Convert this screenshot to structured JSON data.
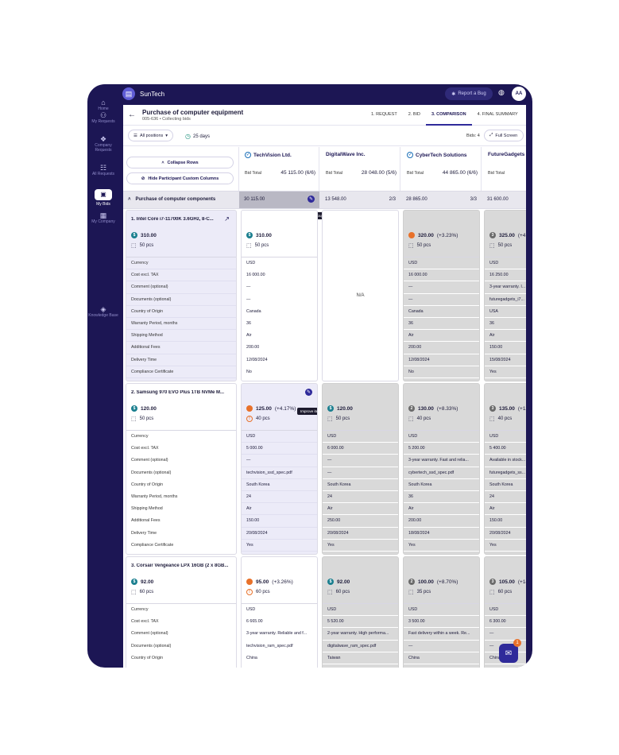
{
  "app": {
    "brand": "SunTech",
    "report_bug": "Report a Bug",
    "avatar": "AA"
  },
  "sidebar": [
    {
      "label": "Home",
      "icon": "home-icon"
    },
    {
      "label": "My Requests",
      "icon": "requests-icon"
    },
    {
      "label": "Company Requests",
      "icon": "company-requests-icon"
    },
    {
      "label": "All Requests",
      "icon": "all-requests-icon"
    },
    {
      "label": "My Bids",
      "icon": "bids-icon",
      "active": true
    },
    {
      "label": "My Company",
      "icon": "company-icon"
    },
    {
      "label": "Knowledge Base",
      "icon": "knowledge-icon"
    }
  ],
  "header": {
    "title": "Purchase of computer equipment",
    "subtitle": "005-636 • Collecting bids",
    "steps": [
      "1. REQUEST",
      "2. BID",
      "3. COMPARISON",
      "4. FINAL SUMMARY"
    ]
  },
  "toolbar": {
    "positions": "All positions",
    "days": "25 days",
    "bids": "Bids: 4",
    "fullscreen": "Full Screen",
    "collapse": "Collapse Rows",
    "hide_columns": "Hide Participant Custom Columns"
  },
  "suppliers": [
    {
      "name": "TechVision Ltd.",
      "bid_total_label": "Bid Total",
      "bid_total": "45 115.00 (6/6)",
      "verified": true
    },
    {
      "name": "DigitalWave Inc.",
      "bid_total_label": "Bid Total",
      "bid_total": "28 048.00 (5/6)",
      "verified": false
    },
    {
      "name": "CyberTech Solutions",
      "bid_total_label": "Bid Total",
      "bid_total": "44 865.00 (6/6)",
      "verified": true
    },
    {
      "name": "FutureGadgets C",
      "bid_total_label": "Bid Total",
      "bid_total": "",
      "verified": false
    }
  ],
  "group": {
    "title": "Purchase of computer components",
    "totals": [
      {
        "value": "30 115.00",
        "count": ""
      },
      {
        "value": "13 548.00",
        "count": "2/3"
      },
      {
        "value": "28 865.00",
        "count": "3/3"
      },
      {
        "value": "31 600.00",
        "count": ""
      }
    ],
    "tooltip_group": "Improve group",
    "tooltip_item": "Improve item"
  },
  "field_labels": [
    "Currency",
    "Cost excl. TAX",
    "Comment (optional)",
    "Documents (optional)",
    "Country of Origin",
    "Warranty Period, months",
    "Shipping Method",
    "Additional Fees",
    "Delivery Time",
    "Compliance Certificate"
  ],
  "items": [
    {
      "name": "1. Intel Core i7-11700K 3.6GHz, 8-C...",
      "price": "310.00",
      "qty": "50 pcs",
      "offers": [
        {
          "price": "310.00",
          "delta": "",
          "qty": "50 pcs",
          "dot": "teal",
          "values": [
            "USD",
            "16 000.00",
            "—",
            "—",
            "Canada",
            "36",
            "Air",
            "200.00",
            "12/08/2024",
            "No"
          ]
        },
        {
          "na": "N/A"
        },
        {
          "price": "320.00",
          "delta": "(+3.23%)",
          "qty": "50 pcs",
          "dot": "orange",
          "values": [
            "USD",
            "16 000.00",
            "—",
            "—",
            "Canada",
            "36",
            "Air",
            "200.00",
            "12/08/2024",
            "No"
          ]
        },
        {
          "price": "325.00",
          "delta": "(+4...",
          "qty": "50 pcs",
          "dot": "gray",
          "values": [
            "USD",
            "16 250.00",
            "3-year warranty. I...",
            "futuregadgets_i7...",
            "USA",
            "36",
            "Air",
            "150.00",
            "15/08/2024",
            "Yes"
          ]
        }
      ]
    },
    {
      "name": "2. Samsung 970 EVO Plus 1TB NVMe M...",
      "price": "120.00",
      "qty": "50 pcs",
      "offers": [
        {
          "price": "125.00",
          "delta": "(+4.17%)",
          "qty": "40 pcs",
          "dot": "orange",
          "warn": true,
          "values": [
            "USD",
            "5 000.00",
            "—",
            "techvision_ssd_spec.pdf",
            "South Korea",
            "24",
            "Air",
            "150.00",
            "20/08/2024",
            "Yes"
          ]
        },
        {
          "price": "120.00",
          "delta": "",
          "qty": "50 pcs",
          "dot": "teal",
          "values": [
            "USD",
            "6 000.00",
            "—",
            "—",
            "South Korea",
            "24",
            "Air",
            "250.00",
            "20/08/2024",
            "Yes"
          ]
        },
        {
          "price": "130.00",
          "delta": "(+8.33%)",
          "qty": "40 pcs",
          "dot": "gray",
          "values": [
            "USD",
            "5 200.00",
            "3-year warranty. Fast and relia...",
            "cybertech_ssd_spec.pdf",
            "South Korea",
            "36",
            "Air",
            "200.00",
            "18/08/2024",
            "Yes"
          ]
        },
        {
          "price": "135.00",
          "delta": "(+12...",
          "qty": "40 pcs",
          "dot": "gray",
          "values": [
            "USD",
            "5 400.00",
            "Available in stock...",
            "futuregadgets_ss...",
            "South Korea",
            "24",
            "Air",
            "150.00",
            "20/08/2024",
            "Yes"
          ]
        }
      ]
    },
    {
      "name": "3. Corsair Vengeance LPX 16GB (2 x 8GB...",
      "price": "92.00",
      "qty": "60 pcs",
      "offers": [
        {
          "price": "95.00",
          "delta": "(+3.26%)",
          "qty": "60 pcs",
          "dot": "orange",
          "warn": true,
          "values": [
            "USD",
            "6 665.00",
            "3-year warranty. Reliable and f...",
            "techvision_ram_spec.pdf",
            "China",
            "36"
          ]
        },
        {
          "price": "92.00",
          "delta": "",
          "qty": "60 pcs",
          "dot": "teal",
          "values": [
            "USD",
            "5 520.00",
            "2-year warranty. High performa...",
            "digitalwave_ram_spec.pdf",
            "Taiwan",
            "24"
          ]
        },
        {
          "price": "100.00",
          "delta": "(+8.70%)",
          "qty": "35 pcs",
          "dot": "gray",
          "values": [
            "USD",
            "3 500.00",
            "Fast delivery within a week. Re...",
            "—",
            "China",
            "24"
          ]
        },
        {
          "price": "105.00",
          "delta": "(+14...",
          "qty": "60 pcs",
          "dot": "gray",
          "values": [
            "USD",
            "6 300.00",
            "—",
            "—",
            "China",
            "24"
          ]
        }
      ]
    }
  ],
  "chat": {
    "badge": "1"
  }
}
